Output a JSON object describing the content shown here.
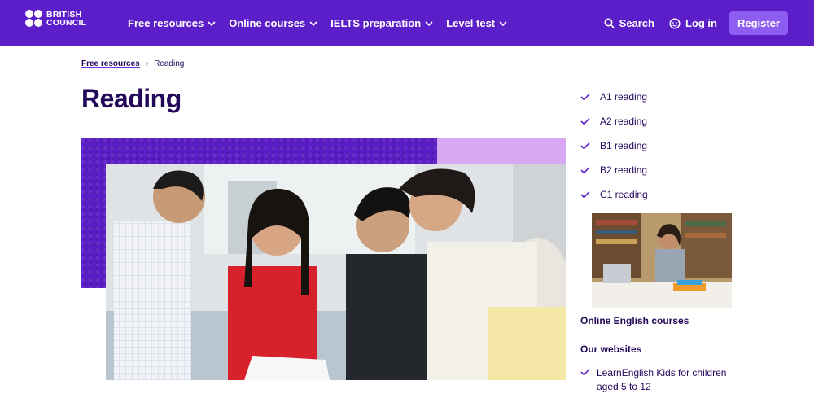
{
  "header": {
    "logo_line1": "BRITISH",
    "logo_line2": "COUNCIL",
    "nav": [
      {
        "label": "Free resources"
      },
      {
        "label": "Online courses"
      },
      {
        "label": "IELTS preparation"
      },
      {
        "label": "Level test"
      }
    ],
    "search_label": "Search",
    "login_label": "Log in",
    "register_label": "Register"
  },
  "breadcrumb": {
    "parent": "Free resources",
    "separator": "›",
    "current": "Reading"
  },
  "page_title": "Reading",
  "sidebar": {
    "levels": [
      {
        "label": "A1 reading"
      },
      {
        "label": "A2 reading"
      },
      {
        "label": "B1 reading"
      },
      {
        "label": "B2 reading"
      },
      {
        "label": "C1 reading"
      }
    ],
    "promo_title": "Online English courses",
    "sites_heading": "Our websites",
    "sites": [
      {
        "label": "LearnEnglish Kids for children aged 5 to 12"
      }
    ]
  },
  "colors": {
    "brand_purple": "#5b1ec9",
    "dark_text": "#23085a",
    "lilac": "#d8a8f5",
    "register_button": "#8c5df0"
  }
}
